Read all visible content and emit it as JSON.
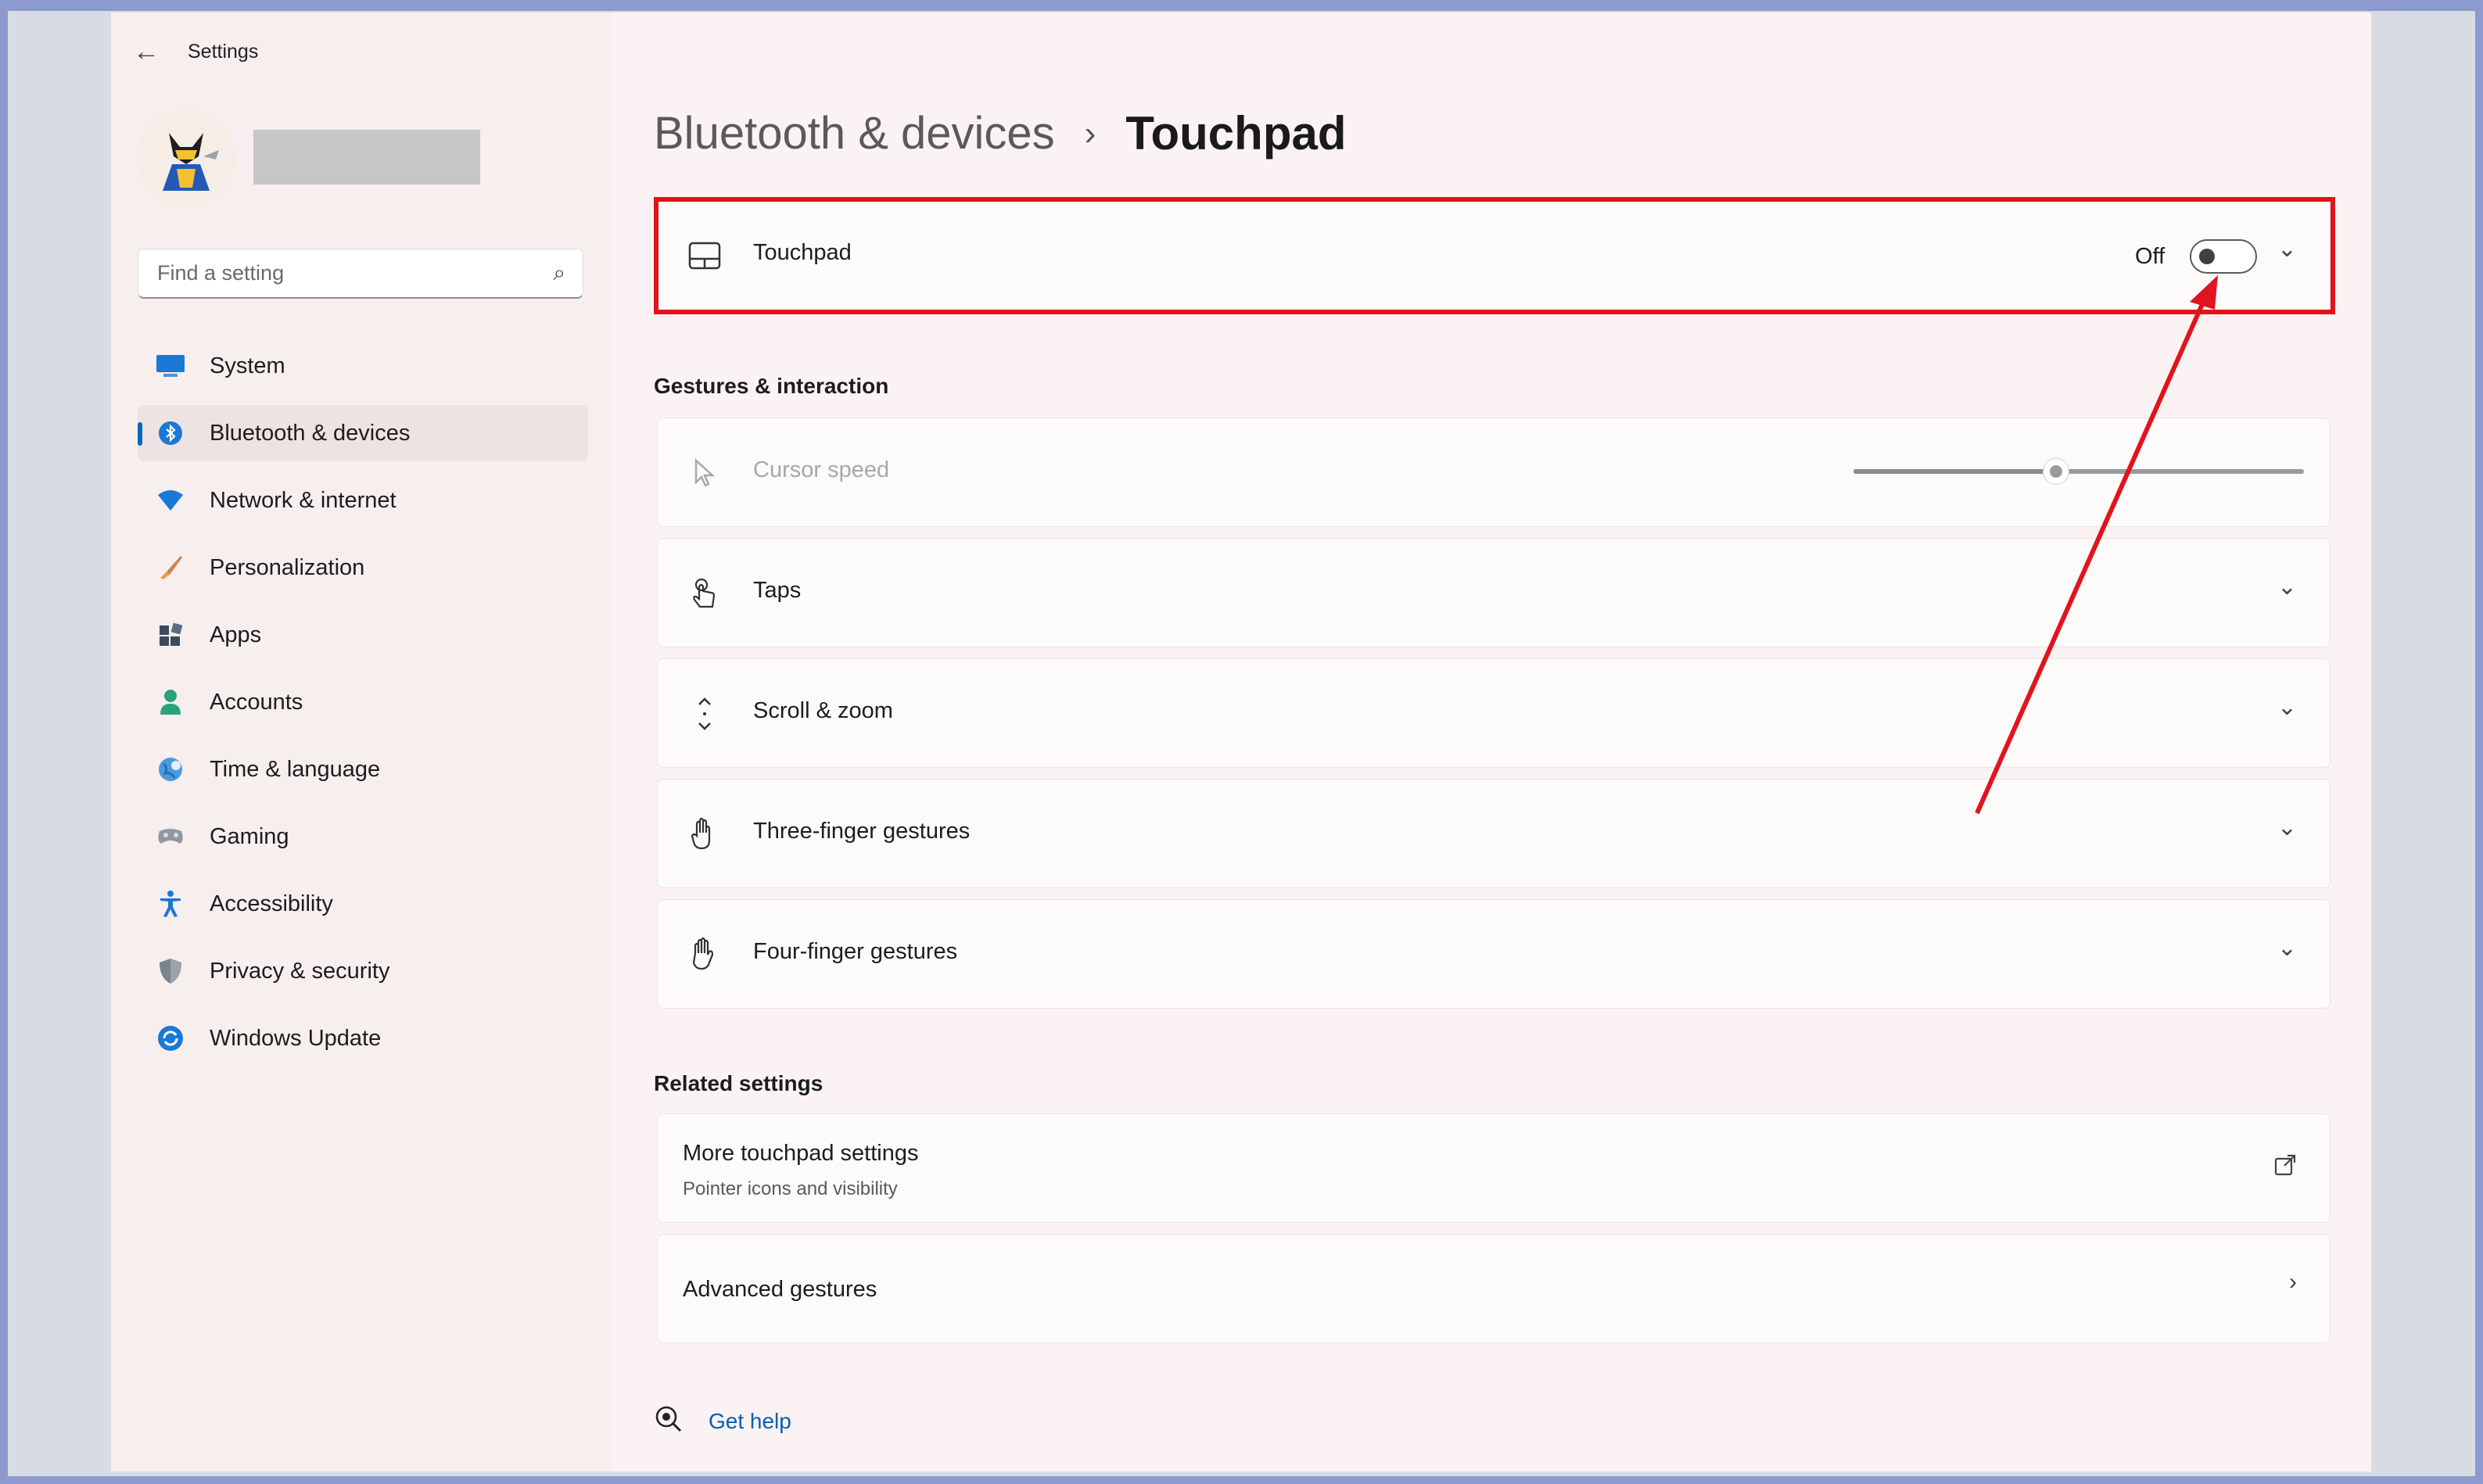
{
  "window": {
    "title": "Settings",
    "back_label": "←"
  },
  "search": {
    "placeholder": "Find a setting",
    "value": ""
  },
  "nav": {
    "items": [
      {
        "label": "System",
        "icon": "monitor-icon"
      },
      {
        "label": "Bluetooth & devices",
        "icon": "bluetooth-icon",
        "active": true
      },
      {
        "label": "Network & internet",
        "icon": "wifi-icon"
      },
      {
        "label": "Personalization",
        "icon": "brush-icon"
      },
      {
        "label": "Apps",
        "icon": "apps-icon"
      },
      {
        "label": "Accounts",
        "icon": "person-icon"
      },
      {
        "label": "Time & language",
        "icon": "globe-clock-icon"
      },
      {
        "label": "Gaming",
        "icon": "controller-icon"
      },
      {
        "label": "Accessibility",
        "icon": "accessibility-icon"
      },
      {
        "label": "Privacy & security",
        "icon": "shield-icon"
      },
      {
        "label": "Windows Update",
        "icon": "refresh-icon"
      }
    ]
  },
  "breadcrumb": {
    "parent": "Bluetooth & devices",
    "separator": "›",
    "current": "Touchpad"
  },
  "touchpad": {
    "label": "Touchpad",
    "state_label": "Off",
    "enabled": false
  },
  "gestures": {
    "title": "Gestures & interaction",
    "cursor_speed": {
      "label": "Cursor speed",
      "value_fraction": 0.45,
      "disabled": true
    },
    "items": [
      {
        "label": "Taps",
        "icon": "tap-icon"
      },
      {
        "label": "Scroll & zoom",
        "icon": "scroll-icon"
      },
      {
        "label": "Three-finger gestures",
        "icon": "hand-icon"
      },
      {
        "label": "Four-finger gestures",
        "icon": "hand-icon"
      }
    ]
  },
  "related": {
    "title": "Related settings",
    "more_touchpad": {
      "label": "More touchpad settings",
      "sub": "Pointer icons and visibility"
    },
    "advanced": {
      "label": "Advanced gestures"
    }
  },
  "help": {
    "label": "Get help"
  },
  "colors": {
    "accent": "#0067c0",
    "highlight": "#e0141e",
    "link": "#005fb8"
  }
}
